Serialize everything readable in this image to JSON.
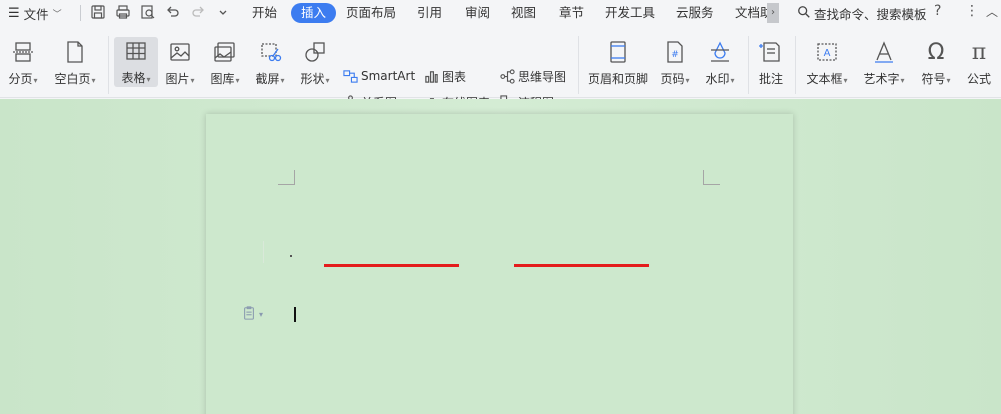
{
  "menubar": {
    "file_label": "文件",
    "tabs": [
      {
        "label": "开始",
        "active": false
      },
      {
        "label": "插入",
        "active": true
      },
      {
        "label": "页面布局",
        "active": false
      },
      {
        "label": "引用",
        "active": false
      },
      {
        "label": "审阅",
        "active": false
      },
      {
        "label": "视图",
        "active": false
      },
      {
        "label": "章节",
        "active": false
      },
      {
        "label": "开发工具",
        "active": false
      },
      {
        "label": "云服务",
        "active": false
      },
      {
        "label": "文档助",
        "active": false
      }
    ],
    "search_label": "查找命令、搜索模板",
    "help_label": "?",
    "more_label": "⋮",
    "collapse_label": "︿"
  },
  "ribbon": {
    "page_break": "分页",
    "blank_page": "空白页",
    "table": "表格",
    "picture": "图片",
    "gallery": "图库",
    "screenshot": "截屏",
    "shapes": "形状",
    "smartart": "SmartArt",
    "chart": "图表",
    "mindmap": "思维导图",
    "relation_chart": "关系图",
    "online_chart": "在线图表",
    "flowchart": "流程图",
    "header_footer": "页眉和页脚",
    "page_number": "页码",
    "watermark": "水印",
    "comment": "批注",
    "textbox": "文本框",
    "wordart": "艺术字",
    "symbol": "符号",
    "formula": "公式"
  },
  "colors": {
    "accent": "#3c7cf0",
    "page_bg": "#cde8cd",
    "red_line": "#e41c1c"
  }
}
